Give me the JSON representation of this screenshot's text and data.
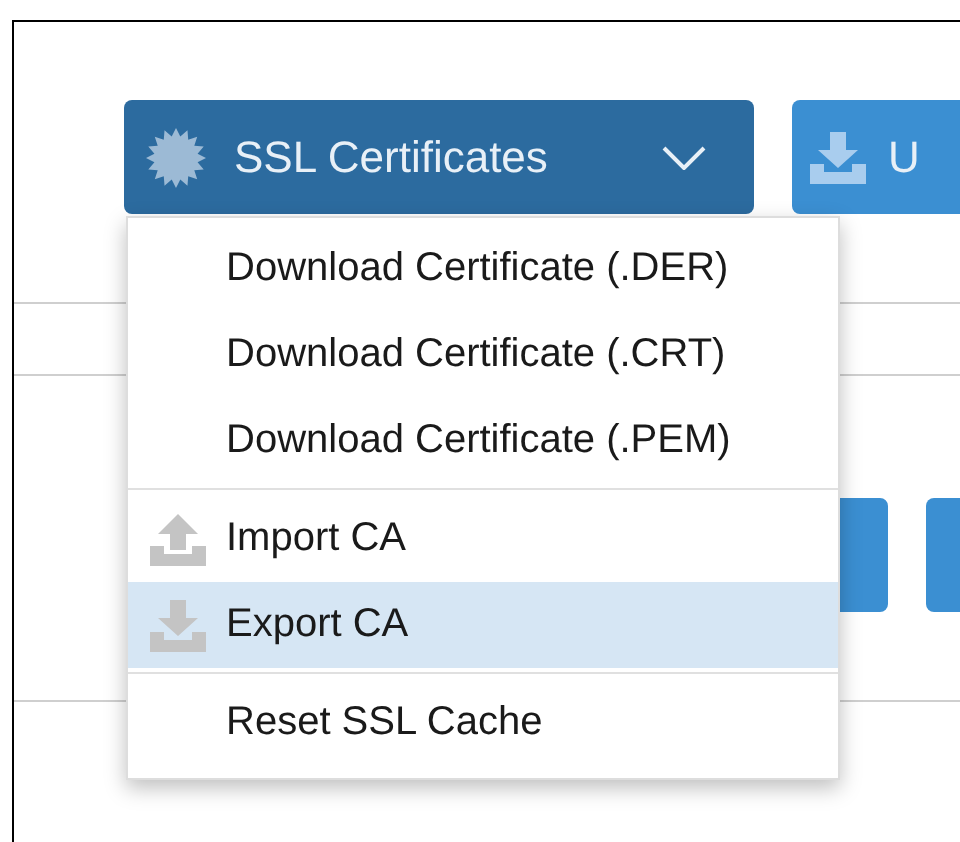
{
  "toolbar": {
    "ssl_button": {
      "label": "SSL Certificates",
      "expanded": true
    },
    "next_button": {
      "label": "U"
    }
  },
  "menu": {
    "sections": [
      {
        "items": [
          {
            "label": "Download Certificate (.DER)",
            "kind": "plain",
            "selected": false
          },
          {
            "label": "Download Certificate (.CRT)",
            "kind": "plain",
            "selected": false
          },
          {
            "label": "Download Certificate (.PEM)",
            "kind": "plain",
            "selected": false
          }
        ]
      },
      {
        "items": [
          {
            "label": "Import CA",
            "kind": "upload",
            "selected": false
          },
          {
            "label": "Export CA",
            "kind": "download",
            "selected": true
          }
        ]
      },
      {
        "items": [
          {
            "label": "Reset SSL Cache",
            "kind": "plain",
            "selected": false
          }
        ]
      }
    ]
  }
}
